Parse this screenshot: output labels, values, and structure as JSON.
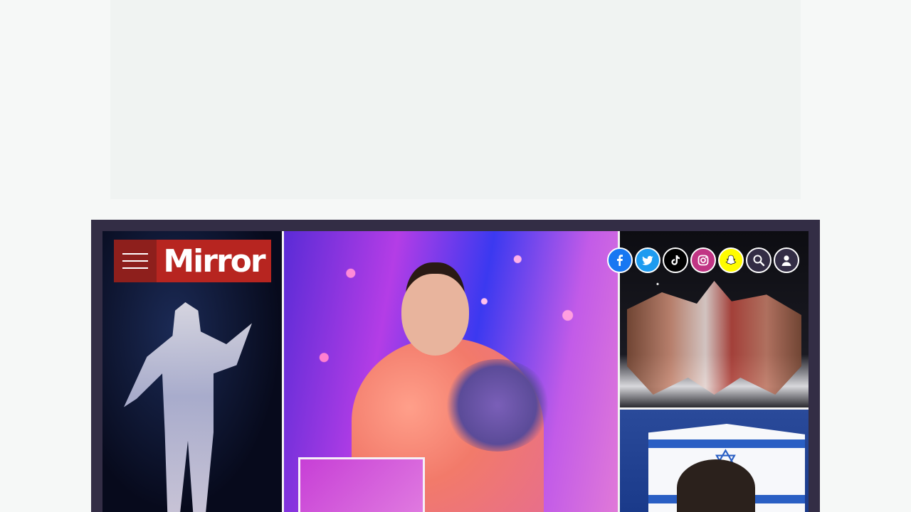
{
  "site": {
    "logo_text": "Mirror",
    "brand_color": "#b72520",
    "menu_color": "#8e1f1c"
  },
  "header": {
    "social_icons": [
      {
        "name": "facebook-icon",
        "color": "#1877f2"
      },
      {
        "name": "twitter-icon",
        "color": "#1d9bf0"
      },
      {
        "name": "tiktok-icon",
        "color": "#000000"
      },
      {
        "name": "instagram-icon",
        "color": "#c13584"
      },
      {
        "name": "snapchat-icon",
        "color": "#fffc00"
      },
      {
        "name": "search-icon",
        "color": "#332d45"
      },
      {
        "name": "account-icon",
        "color": "#332d45"
      }
    ]
  },
  "colors": {
    "page_bg": "#f6f8f7",
    "ad_bg": "#f0f3f2",
    "frame_bg": "#332d45"
  }
}
